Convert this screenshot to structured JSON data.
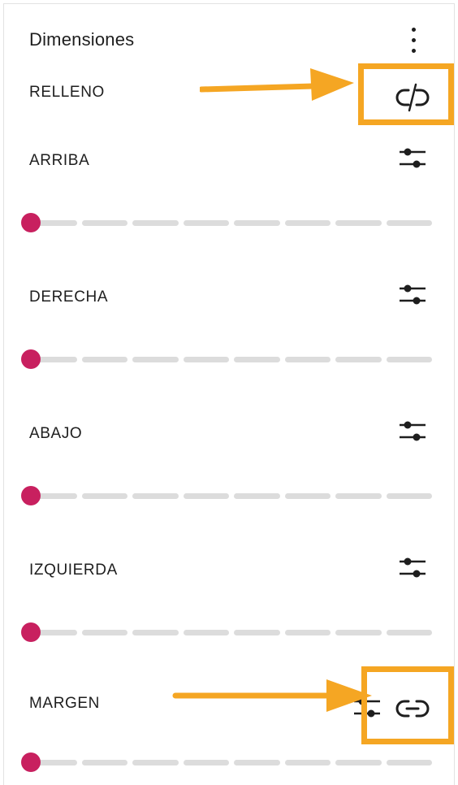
{
  "panel": {
    "title": "Dimensiones"
  },
  "padding": {
    "label": "RELLENO",
    "link_icon": "unlink-icon"
  },
  "sides": [
    {
      "label": "ARRIBA",
      "icon": "sliders-icon",
      "value_fraction": 0
    },
    {
      "label": "DERECHA",
      "icon": "sliders-icon",
      "value_fraction": 0
    },
    {
      "label": "ABAJO",
      "icon": "sliders-icon",
      "value_fraction": 0
    },
    {
      "label": "IZQUIERDA",
      "icon": "sliders-icon",
      "value_fraction": 0
    }
  ],
  "margin": {
    "label": "MARGEN",
    "icon": "sliders-icon",
    "link_icon": "link-icon",
    "value_fraction": 0
  },
  "colors": {
    "accent_thumb": "#c8205f",
    "annotation": "#f5a623",
    "track": "#dcdcdc"
  }
}
